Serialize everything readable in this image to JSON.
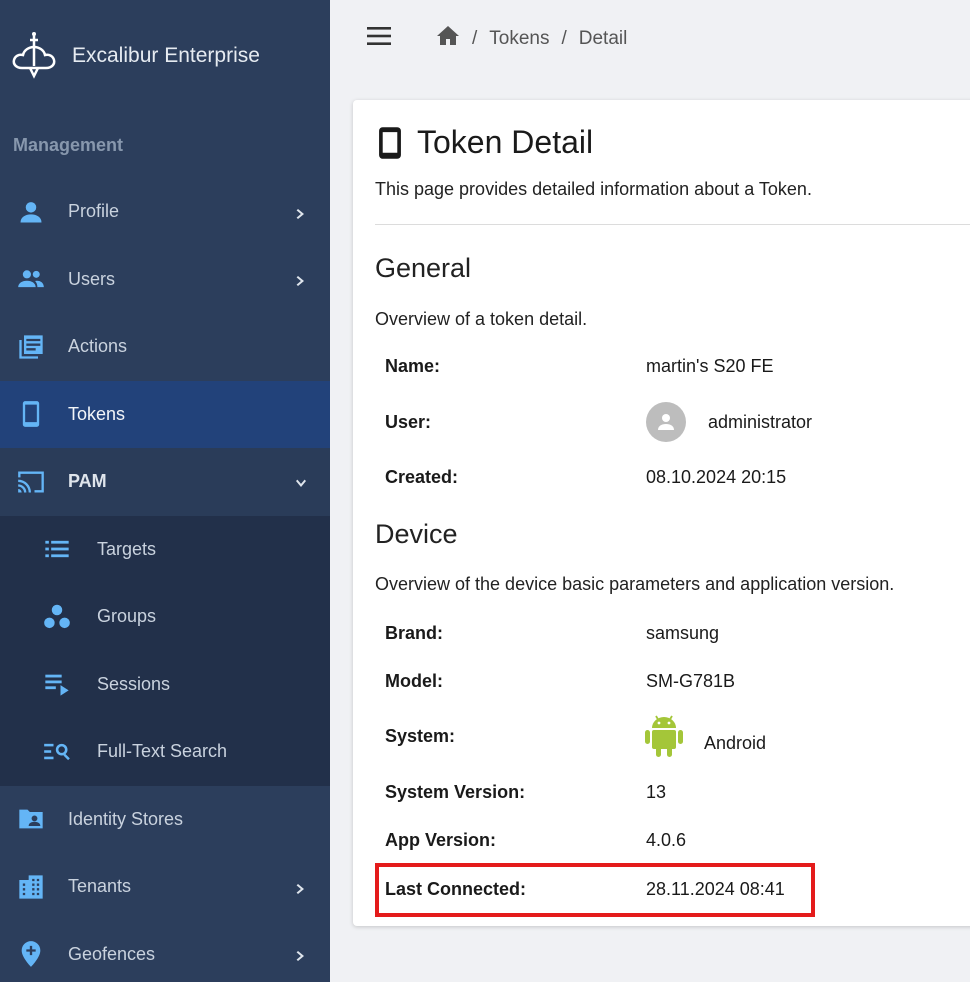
{
  "brand": {
    "name": "Excalibur Enterprise"
  },
  "sidebar": {
    "section_label": "Management",
    "items": [
      {
        "label": "Profile",
        "icon": "person-icon"
      },
      {
        "label": "Users",
        "icon": "users-icon"
      },
      {
        "label": "Actions",
        "icon": "actions-icon"
      },
      {
        "label": "Tokens",
        "icon": "phone-icon"
      },
      {
        "label": "PAM",
        "icon": "cast-icon"
      },
      {
        "label": "Identity Stores",
        "icon": "folder-user-icon"
      },
      {
        "label": "Tenants",
        "icon": "building-icon"
      },
      {
        "label": "Geofences",
        "icon": "location-add-icon"
      }
    ],
    "pam_sub": [
      {
        "label": "Targets",
        "icon": "list-icon"
      },
      {
        "label": "Groups",
        "icon": "groups-icon"
      },
      {
        "label": "Sessions",
        "icon": "playlist-play-icon"
      },
      {
        "label": "Full-Text Search",
        "icon": "search-list-icon"
      }
    ]
  },
  "breadcrumb": {
    "items": [
      "Tokens",
      "Detail"
    ],
    "separator": "/"
  },
  "page": {
    "title": "Token Detail",
    "subtitle": "This page provides detailed information about a Token."
  },
  "general": {
    "heading": "General",
    "description": "Overview of a token detail.",
    "name_label": "Name:",
    "name_value": "martin's S20 FE",
    "user_label": "User:",
    "user_value": "administrator",
    "created_label": "Created:",
    "created_value": "08.10.2024 20:15"
  },
  "device": {
    "heading": "Device",
    "description": "Overview of the device basic parameters and application version.",
    "brand_label": "Brand:",
    "brand_value": "samsung",
    "model_label": "Model:",
    "model_value": "SM-G781B",
    "system_label": "System:",
    "system_value": "Android",
    "system_version_label": "System Version:",
    "system_version_value": "13",
    "app_version_label": "App Version:",
    "app_version_value": "4.0.6",
    "last_connected_label": "Last Connected:",
    "last_connected_value": "28.11.2024 08:41"
  },
  "colors": {
    "sidebar_bg": "#2c3e5c",
    "active_item": "#22427a",
    "icon_accent": "#64b5f6",
    "highlight": "#e41b1b",
    "android_green": "#a4c639"
  }
}
